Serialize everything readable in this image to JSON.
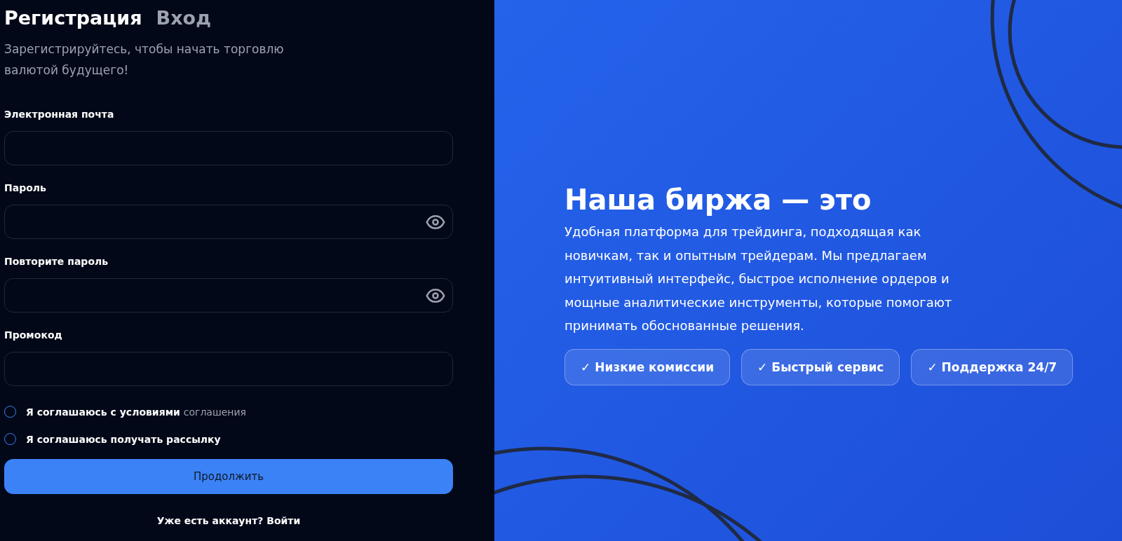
{
  "tabs": [
    {
      "label": "Регистрация",
      "selected": true
    },
    {
      "label": "Вход",
      "selected": false
    }
  ],
  "subtitle": "Зарегистрируйтесь, чтобы начать торговлю валютой будущего!",
  "fields": [
    {
      "label": "Электронная почта",
      "kind": "text"
    },
    {
      "label": "Пароль",
      "kind": "password"
    },
    {
      "label": "Повторите пароль",
      "kind": "password"
    },
    {
      "label": "Промокод",
      "kind": "text"
    }
  ],
  "agreements": [
    {
      "text": "Я соглашаюсь с условиями",
      "link": "соглашения",
      "checked": false
    },
    {
      "text": "Я соглашаюсь получать рассылку",
      "checked": false
    }
  ],
  "submit_button": "Продолжить",
  "footer_text": "Уже есть аккаунт? Войти",
  "promo": {
    "title": "Наша биржа — это",
    "description": "Удобная платформа для трейдинга, подходящая как новичкам, так и опытным трейдерам. Мы предлагаем интуитивный интерфейс, быстрое исполнение ордеров и мощные аналитические инструменты, которые помогают принимать обоснованные решения.",
    "features": [
      "✓ Низкие комиссии",
      "✓ Быстрый сервис",
      "✓ Поддержка 24/7"
    ]
  }
}
